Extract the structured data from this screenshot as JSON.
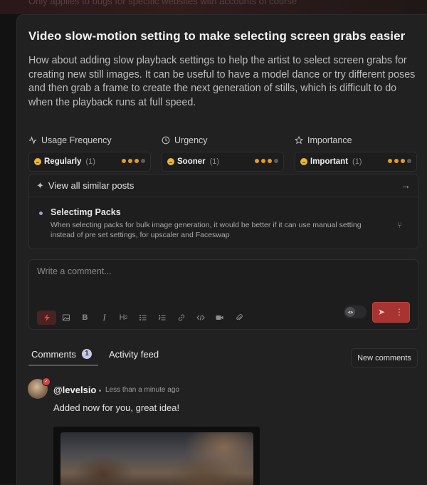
{
  "top_banner": "Only applies to bugs for specific websites with accounts of course",
  "post": {
    "title": "Video slow-motion setting to make selecting screen grabs easier",
    "description": "How about adding slow playback settings to help the artist to select screen grabs for creating new still images. It can be useful to have a model dance or try different poses and then grab a frame to create the next generation of stills, which is difficult to do when the playback runs at full speed."
  },
  "metrics": [
    {
      "heading": "Usage Frequency",
      "icon": "activity-icon",
      "value": "Regularly",
      "count": "(1)",
      "level": 3,
      "max": 4
    },
    {
      "heading": "Urgency",
      "icon": "clock-icon",
      "value": "Sooner",
      "count": "(1)",
      "level": 3,
      "max": 4
    },
    {
      "heading": "Importance",
      "icon": "star-icon",
      "value": "Important",
      "count": "(1)",
      "level": 3,
      "max": 4
    }
  ],
  "similar": {
    "header": "View all similar posts",
    "items": [
      {
        "title": "Selectimg Packs",
        "body": "When selecting packs for bulk image generation, it would be better if it can use manual setting instead of pre set settings, for upscaler and Faceswap"
      }
    ]
  },
  "composer": {
    "placeholder": "Write a comment...",
    "tools": [
      "lightning-icon",
      "image-icon",
      "bold-icon",
      "italic-icon",
      "heading-icon",
      "bullet-list-icon",
      "numbered-list-icon",
      "link-icon",
      "code-icon",
      "video-icon",
      "attachment-icon"
    ],
    "accent": "#a83432"
  },
  "tabs": {
    "comments_label": "Comments",
    "comments_count": "1",
    "activity_label": "Activity feed",
    "new_comments_label": "New comments"
  },
  "comment": {
    "username": "@levelsio",
    "time": "Less than a minute ago",
    "text": "Added now for you, great idea!"
  },
  "colors": {
    "dot_on": "#e59a2b",
    "dot_off": "#5c5c5e",
    "badge": "#c8cbe7"
  }
}
